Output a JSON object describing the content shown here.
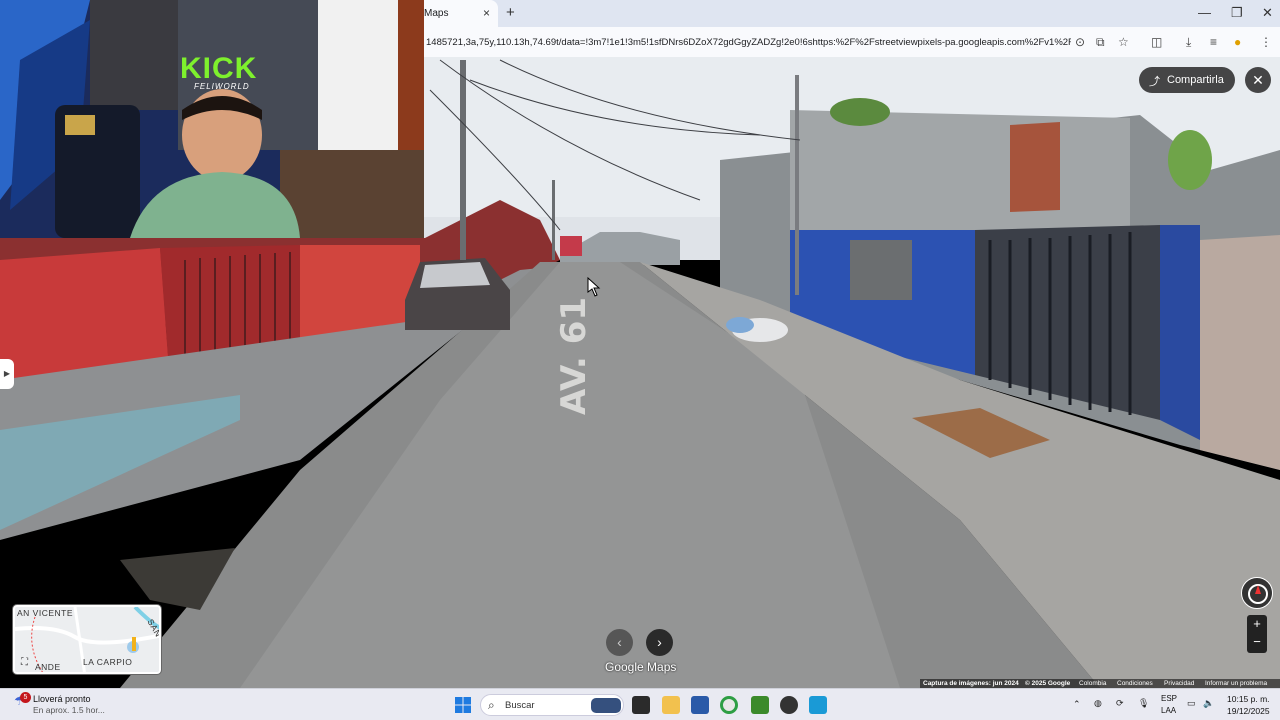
{
  "browser": {
    "tab_title": "Maps",
    "tab_close": "×",
    "new_tab": "+",
    "url": "1485721,3a,75y,110.13h,74.69t/data=!3m7!1e1!3m5!1sfDNrs6DZoX72gdGgyZADZg!2e0!6shttps:%2F%2Fstreetviewpixels-pa.googleapis.com%2Fv1%2Fthu...",
    "window_controls": {
      "minimize": "—",
      "maximize": "❐",
      "close": "✕"
    }
  },
  "webcam": {
    "brand": "KICK",
    "brand_sub": "FELIWORLD"
  },
  "street_view": {
    "street_marking": "AV. 61",
    "share_label": "Compartirla",
    "close_label": "✕",
    "side_toggle": "▶",
    "nav_prev": "‹",
    "nav_next": "›",
    "logo": "Google Maps",
    "zoom_in": "+",
    "zoom_out": "−",
    "minimap": {
      "label_top": "AN VICENTE",
      "label_right": "SAN",
      "label_bottom_left": "ANDE",
      "label_bottom": "LA CARPIO",
      "expand_icon": "⛶"
    },
    "attribution": {
      "capture": "Captura de imágenes: jun 2024",
      "copyright": "© 2025 Google",
      "country": "Colombia",
      "terms": "Condiciones",
      "privacy": "Privacidad",
      "report": "Informar un problema"
    }
  },
  "taskbar": {
    "weather_badge": "5",
    "weather_title": "Lloverá pronto",
    "weather_sub": "En aprox. 1.5 hor...",
    "search_placeholder": "Buscar",
    "lang_top": "ESP",
    "lang_bottom": "LAA",
    "time": "10:15 p. m.",
    "date": "19/12/2025"
  },
  "colors": {
    "browser_tabbar": "#dfe5f1",
    "webcam_green": "#7ef02d",
    "taskbar": "#e9eaf2"
  }
}
